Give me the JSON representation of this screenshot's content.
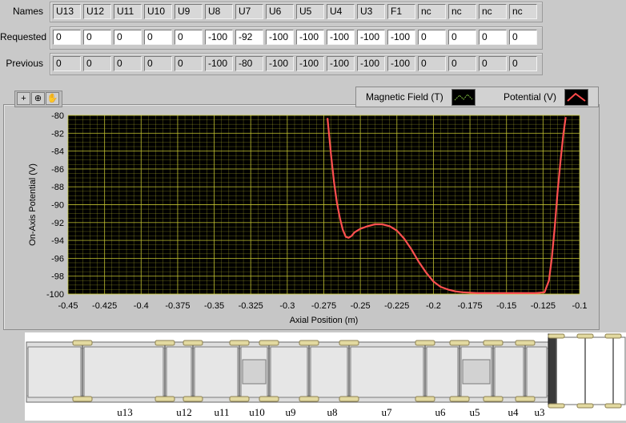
{
  "table": {
    "names_label": "Names",
    "requested_label": "Requested",
    "previous_label": "Previous",
    "names": [
      "U13",
      "U12",
      "U11",
      "U10",
      "U9",
      "U8",
      "U7",
      "U6",
      "U5",
      "U4",
      "U3",
      "F1",
      "nc",
      "nc",
      "nc",
      "nc"
    ],
    "requested": [
      "0",
      "0",
      "0",
      "0",
      "0",
      "-100",
      "-92",
      "-100",
      "-100",
      "-100",
      "-100",
      "-100",
      "0",
      "0",
      "0",
      "0"
    ],
    "previous": [
      "0",
      "0",
      "0",
      "0",
      "0",
      "-100",
      "-80",
      "-100",
      "-100",
      "-100",
      "-100",
      "-100",
      "0",
      "0",
      "0",
      "0"
    ]
  },
  "graph": {
    "legend": [
      {
        "label": "Magnetic Field (T)",
        "color": "#7fbf3f"
      },
      {
        "label": "Potential (V)",
        "color": "#ff4a4a"
      }
    ],
    "tools": [
      "crosshair-tool",
      "zoom-tool",
      "pan-tool"
    ]
  },
  "chart_data": {
    "type": "line",
    "xlabel": "Axial Position (m)",
    "ylabel": "On-Axis Potential (V)",
    "xlim": [
      -0.45,
      -0.1
    ],
    "ylim": [
      -100,
      -80
    ],
    "xticks": [
      "-0.45",
      "-0.425",
      "-0.4",
      "-0.375",
      "-0.35",
      "-0.325",
      "-0.3",
      "-0.275",
      "-0.25",
      "-0.225",
      "-0.2",
      "-0.175",
      "-0.15",
      "-0.125",
      "-0.1"
    ],
    "yticks": [
      "-80",
      "-82",
      "-84",
      "-86",
      "-88",
      "-90",
      "-92",
      "-94",
      "-96",
      "-98",
      "-100"
    ],
    "grid": true,
    "background": "#000000",
    "grid_color": "#c8c832",
    "series": [
      {
        "name": "Potential (V)",
        "color": "#ff5050",
        "x": [
          -0.2725,
          -0.27,
          -0.268,
          -0.266,
          -0.264,
          -0.262,
          -0.26,
          -0.258,
          -0.256,
          -0.254,
          -0.25,
          -0.245,
          -0.24,
          -0.235,
          -0.23,
          -0.225,
          -0.22,
          -0.215,
          -0.21,
          -0.205,
          -0.2,
          -0.195,
          -0.19,
          -0.185,
          -0.18,
          -0.175,
          -0.17,
          -0.16,
          -0.15,
          -0.14,
          -0.13,
          -0.124,
          -0.121,
          -0.119,
          -0.117,
          -0.115,
          -0.113,
          -0.111,
          -0.1095
        ],
        "y": [
          -80.3,
          -84.5,
          -87.5,
          -89.8,
          -91.5,
          -92.8,
          -93.6,
          -93.7,
          -93.5,
          -93.1,
          -92.7,
          -92.4,
          -92.2,
          -92.2,
          -92.4,
          -92.9,
          -93.8,
          -95.0,
          -96.4,
          -97.6,
          -98.6,
          -99.2,
          -99.5,
          -99.7,
          -99.8,
          -99.85,
          -99.9,
          -99.9,
          -99.9,
          -99.9,
          -99.9,
          -99.8,
          -98.5,
          -96.0,
          -92.5,
          -88.5,
          -85.0,
          -82.0,
          -80.2
        ]
      }
    ]
  },
  "diagram": {
    "labels": [
      "u13",
      "u12",
      "u11",
      "u10",
      "u9",
      "u8",
      "u7",
      "u6",
      "u5",
      "u4",
      "u3"
    ]
  }
}
